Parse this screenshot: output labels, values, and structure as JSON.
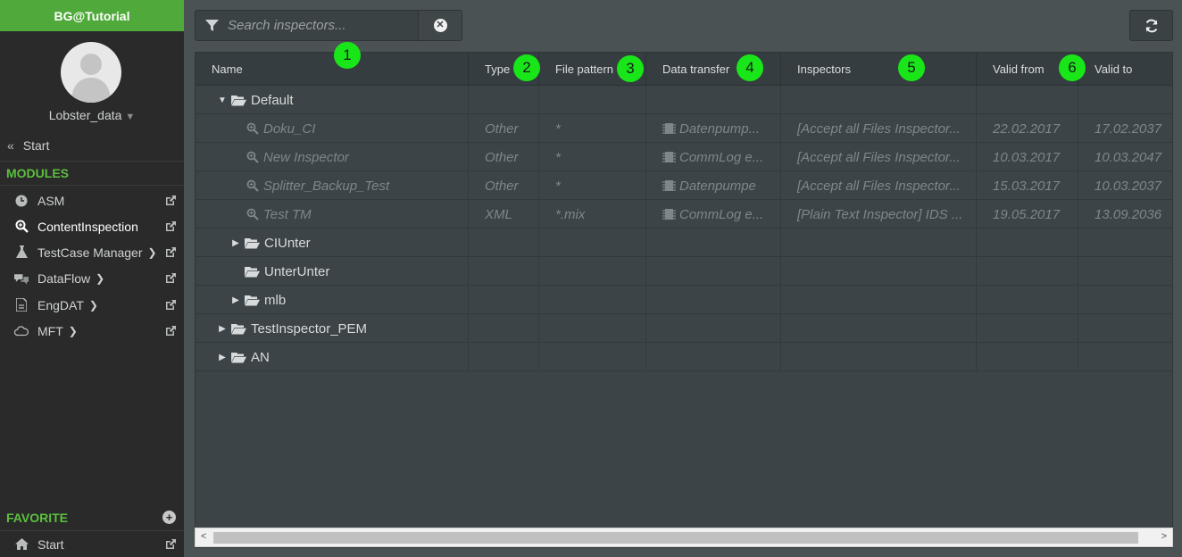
{
  "app": {
    "title": "BG@Tutorial",
    "user": "Lobster_data",
    "start_label": "Start",
    "modules_label": "MODULES",
    "favorite_label": "FAVORITE",
    "favorite_start_label": "Start"
  },
  "modules": [
    {
      "label": "ASM",
      "icon": "clock-icon",
      "has_submenu": false,
      "active": false
    },
    {
      "label": "ContentInspection",
      "icon": "magnifier-icon",
      "has_submenu": false,
      "active": true
    },
    {
      "label": "TestCase Manager",
      "icon": "flask-icon",
      "has_submenu": true,
      "active": false
    },
    {
      "label": "DataFlow",
      "icon": "dataflow-icon",
      "has_submenu": true,
      "active": false
    },
    {
      "label": "EngDAT",
      "icon": "document-icon",
      "has_submenu": true,
      "active": false
    },
    {
      "label": "MFT",
      "icon": "cloud-icon",
      "has_submenu": true,
      "active": false
    }
  ],
  "search": {
    "placeholder": "Search inspectors..."
  },
  "columns": [
    "Name",
    "Type",
    "File pattern",
    "Data transfer",
    "Inspectors",
    "Valid from",
    "Valid to"
  ],
  "rows": [
    {
      "kind": "folder",
      "level": 1,
      "expanded": true,
      "name": "Default"
    },
    {
      "kind": "inspector",
      "level": 2,
      "name": "Doku_CI",
      "type": "Other",
      "pattern": "*",
      "transfer": "Datenpump...",
      "inspectors": "[Accept all Files Inspector...",
      "from": "22.02.2017",
      "to": "17.02.2037"
    },
    {
      "kind": "inspector",
      "level": 2,
      "name": "New Inspector",
      "type": "Other",
      "pattern": "*",
      "transfer": "CommLog e...",
      "inspectors": "[Accept all Files Inspector...",
      "from": "10.03.2017",
      "to": "10.03.2047"
    },
    {
      "kind": "inspector",
      "level": 2,
      "name": "Splitter_Backup_Test",
      "type": "Other",
      "pattern": "*",
      "transfer": "Datenpumpe",
      "inspectors": "[Accept all Files Inspector...",
      "from": "15.03.2017",
      "to": "10.03.2037"
    },
    {
      "kind": "inspector",
      "level": 2,
      "name": "Test TM",
      "type": "XML",
      "pattern": "*.mix",
      "transfer": "CommLog e...",
      "inspectors": "[Plain Text Inspector] IDS ...",
      "from": "19.05.2017",
      "to": "13.09.2036"
    },
    {
      "kind": "folder",
      "level": 2,
      "expanded": false,
      "has_children": true,
      "name": "CIUnter"
    },
    {
      "kind": "folder",
      "level": 2,
      "expanded": false,
      "has_children": false,
      "name": "UnterUnter"
    },
    {
      "kind": "folder",
      "level": 2,
      "expanded": false,
      "has_children": true,
      "name": "mlb"
    },
    {
      "kind": "folder",
      "level": 1,
      "expanded": false,
      "has_children": true,
      "name": "TestInspector_PEM"
    },
    {
      "kind": "folder",
      "level": 1,
      "expanded": false,
      "has_children": true,
      "name": "AN"
    }
  ],
  "callouts": [
    "1",
    "2",
    "3",
    "4",
    "5",
    "6"
  ],
  "colors": {
    "accent": "#50a93b",
    "section": "#5cbf3e",
    "callout": "#19e619"
  }
}
